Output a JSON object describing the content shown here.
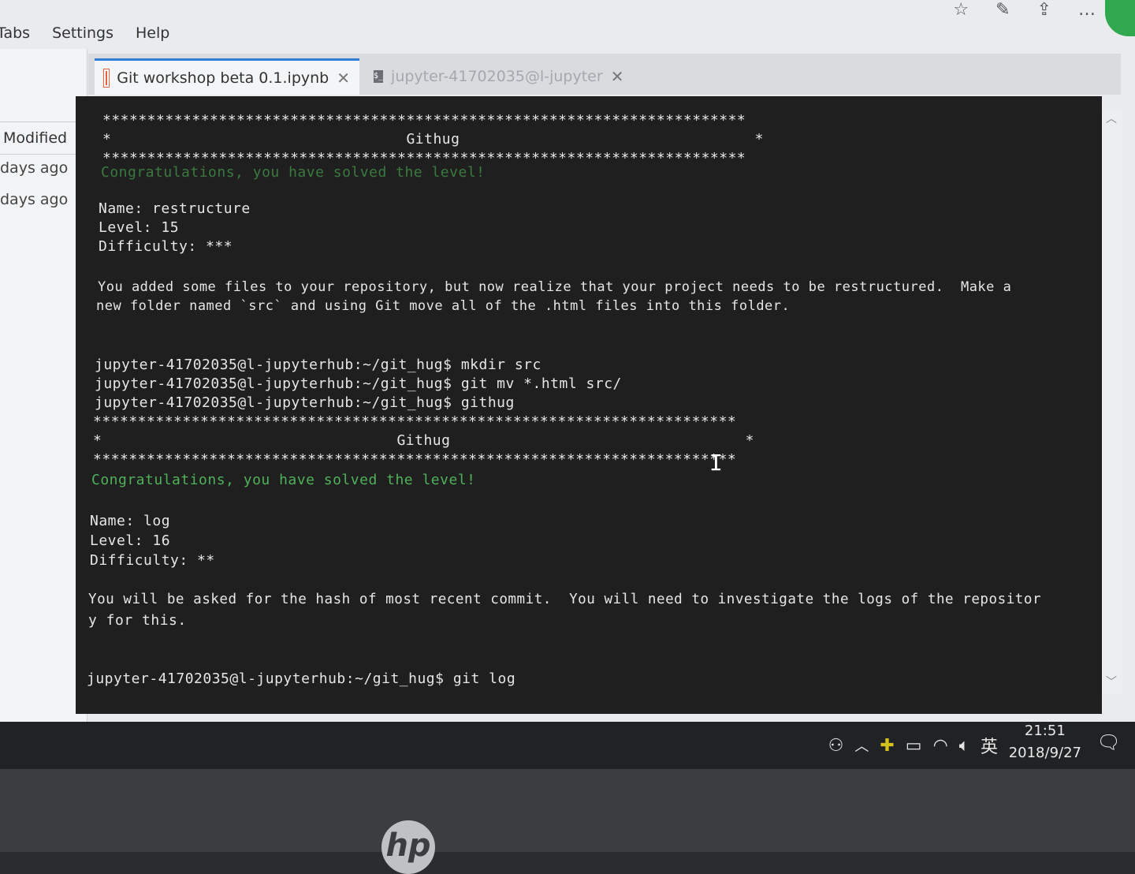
{
  "menu": {
    "tabs": "Tabs",
    "settings": "Settings",
    "help": "Help"
  },
  "file_browser": {
    "modified_header": "Modified",
    "rows": [
      "days ago",
      "days ago"
    ]
  },
  "tabs": [
    {
      "label": "Git workshop beta 0.1.ipynb",
      "icon": "notebook-icon",
      "active": true
    },
    {
      "label": "jupyter-41702035@l-jupyter",
      "icon": "terminal-icon",
      "active": false
    }
  ],
  "terminal": {
    "stars_a": "************************************************************************",
    "stars_b": "************************************************************************",
    "githug_title_1": "*                                 Githug                                 *",
    "congrats_1": "Congratulations, you have solved the level!",
    "level15": {
      "name": "Name: restructure",
      "level": "Level: 15",
      "difficulty": "Difficulty: ***"
    },
    "desc15_1": "You added some files to your repository, but now realize that your project needs to be restructured.  Make a",
    "desc15_2": "new folder named `src` and using Git move all of the .html files into this folder.",
    "cmd1": "jupyter-41702035@l-jupyterhub:~/git_hug$ mkdir src",
    "cmd2": "jupyter-41702035@l-jupyterhub:~/git_hug$ git mv *.html src/",
    "cmd3": "jupyter-41702035@l-jupyterhub:~/git_hug$ githug",
    "githug_title_2": "*                                 Githug                                 *",
    "congrats_2": "Congratulations, you have solved the level!",
    "level16": {
      "name": "Name: log",
      "level": "Level: 16",
      "difficulty": "Difficulty: **"
    },
    "desc16_1": "You will be asked for the hash of most recent commit.  You will need to investigate the logs of the repositor",
    "desc16_2": "y for this.",
    "cmd4": "jupyter-41702035@l-jupyterhub:~/git_hug$ git log"
  },
  "taskbar": {
    "ime": "英",
    "time": "21:51",
    "date": "2018/9/27"
  }
}
